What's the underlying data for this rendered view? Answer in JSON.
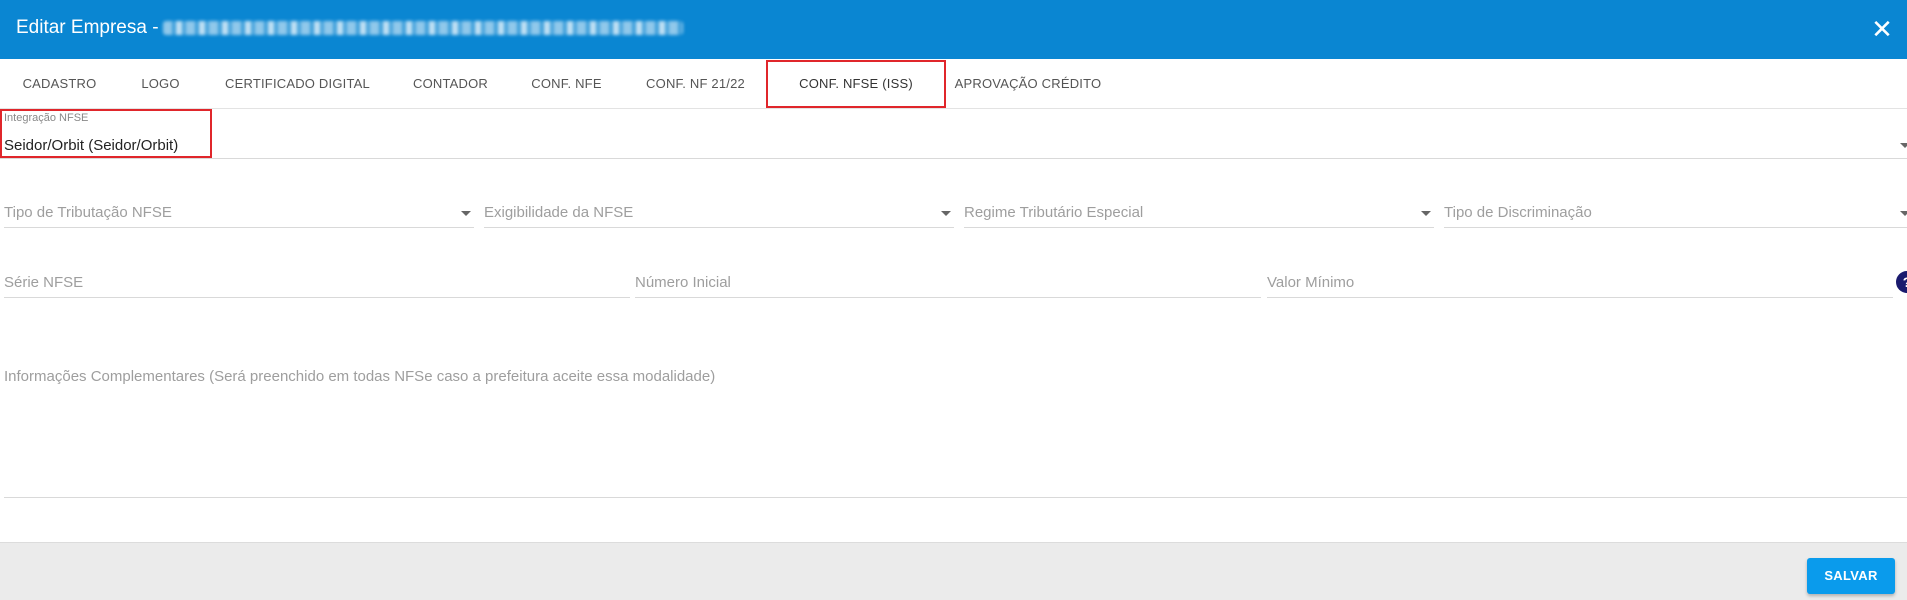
{
  "dialog": {
    "title": "Editar Empresa -",
    "close_glyph": "✕"
  },
  "tabs": [
    {
      "label": "CADASTRO"
    },
    {
      "label": "LOGO"
    },
    {
      "label": "CERTIFICADO DIGITAL"
    },
    {
      "label": "CONTADOR"
    },
    {
      "label": "CONF. NFE"
    },
    {
      "label": "CONF. NF 21/22"
    },
    {
      "label": "CONF. NFSE (ISS)",
      "active": true
    },
    {
      "label": "APROVAÇÃO CRÉDITO"
    }
  ],
  "integration": {
    "label": "Integração NFSE",
    "value": "Seidor/Orbit (Seidor/Orbit)"
  },
  "selects_row": {
    "tipo_tributacao": "Tipo de Tributação NFSE",
    "exigibilidade": "Exigibilidade da NFSE",
    "regime_tributario": "Regime Tributário Especial",
    "tipo_discriminacao": "Tipo de Discriminação"
  },
  "inputs_row": {
    "serie": "Série NFSE",
    "numero_inicial": "Número Inicial",
    "valor_minimo": "Valor Mínimo",
    "help_glyph": "?"
  },
  "informacoes": {
    "placeholder": "Informações Complementares (Será preenchido em todas NFSe caso a prefeitura aceite essa modalidade)"
  },
  "footer": {
    "save_label": "SALVAR"
  },
  "colors": {
    "header": "#0a86d2",
    "highlight": "#e0262b",
    "save_button": "#0a9bec"
  }
}
